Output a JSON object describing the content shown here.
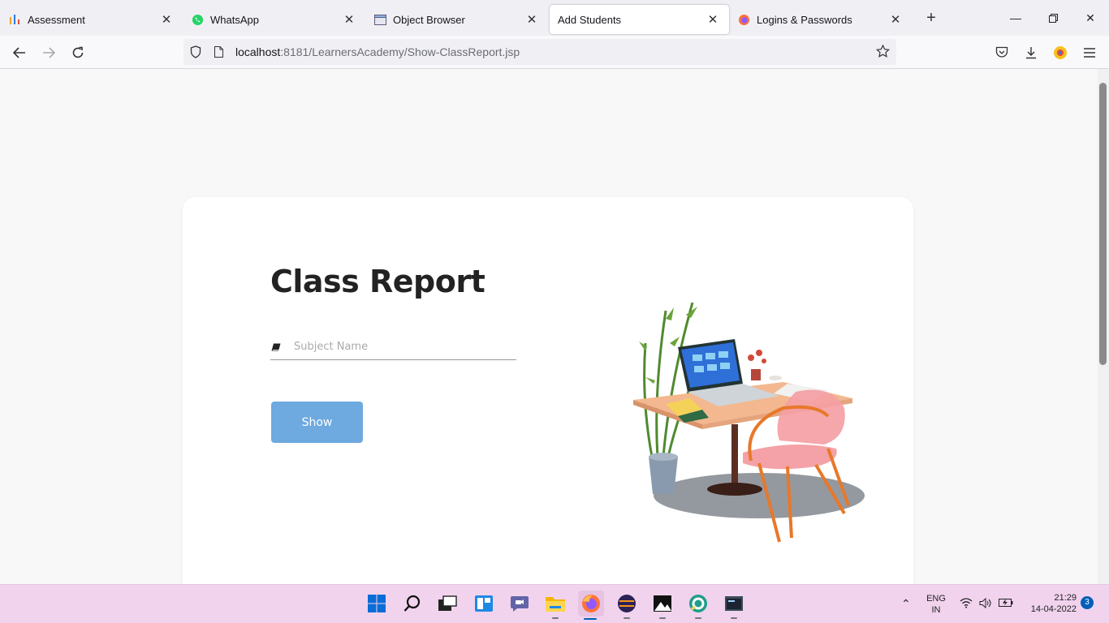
{
  "browser": {
    "tabs": [
      {
        "label": "Assessment",
        "icon": "bar-chart-icon"
      },
      {
        "label": "WhatsApp",
        "icon": "whatsapp-icon"
      },
      {
        "label": "Object Browser",
        "icon": "window-icon"
      },
      {
        "label": "Add Students",
        "icon": "none",
        "active": true
      },
      {
        "label": "Logins & Passwords",
        "icon": "firefox-icon"
      }
    ],
    "url_host": "localhost",
    "url_rest": ":8181/LearnersAcademy/Show-ClassReport.jsp"
  },
  "page": {
    "heading": "Class Report",
    "subject_placeholder": "Subject Name",
    "subject_value": "",
    "show_button": "Show"
  },
  "taskbar": {
    "lang_line1": "ENG",
    "lang_line2": "IN",
    "time": "21:29",
    "date": "14-04-2022",
    "notification_count": "3"
  },
  "colors": {
    "button": "#6ea9e0",
    "taskbar": "#f1d3ee",
    "accent": "#005fb8"
  }
}
